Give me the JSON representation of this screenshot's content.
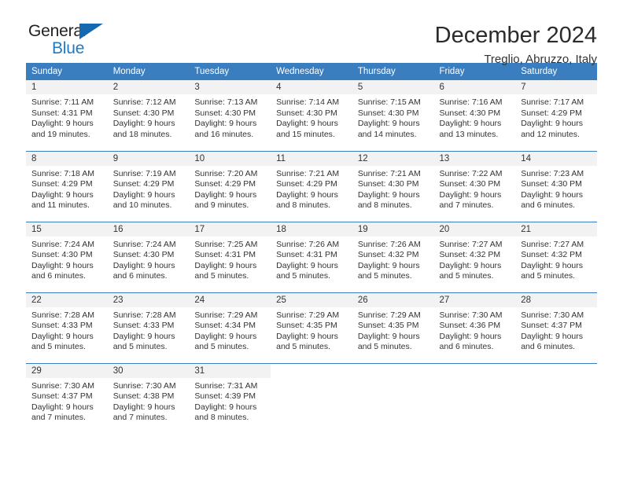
{
  "brand": {
    "name_top": "General",
    "name_bottom": "Blue",
    "triangle_color": "#1469b0",
    "blue_color": "#1e7bc4"
  },
  "header": {
    "title": "December 2024",
    "subtitle": "Treglio, Abruzzo, Italy"
  },
  "theme": {
    "header_bg": "#3a7ebf",
    "header_text": "#ffffff",
    "daynum_bg": "#f2f2f2",
    "body_text": "#333333"
  },
  "weekday_headers": [
    "Sunday",
    "Monday",
    "Tuesday",
    "Wednesday",
    "Thursday",
    "Friday",
    "Saturday"
  ],
  "weeks": [
    [
      {
        "day": "1",
        "sunrise": "Sunrise: 7:11 AM",
        "sunset": "Sunset: 4:31 PM",
        "daylight_line1": "Daylight: 9 hours",
        "daylight_line2": "and 19 minutes."
      },
      {
        "day": "2",
        "sunrise": "Sunrise: 7:12 AM",
        "sunset": "Sunset: 4:30 PM",
        "daylight_line1": "Daylight: 9 hours",
        "daylight_line2": "and 18 minutes."
      },
      {
        "day": "3",
        "sunrise": "Sunrise: 7:13 AM",
        "sunset": "Sunset: 4:30 PM",
        "daylight_line1": "Daylight: 9 hours",
        "daylight_line2": "and 16 minutes."
      },
      {
        "day": "4",
        "sunrise": "Sunrise: 7:14 AM",
        "sunset": "Sunset: 4:30 PM",
        "daylight_line1": "Daylight: 9 hours",
        "daylight_line2": "and 15 minutes."
      },
      {
        "day": "5",
        "sunrise": "Sunrise: 7:15 AM",
        "sunset": "Sunset: 4:30 PM",
        "daylight_line1": "Daylight: 9 hours",
        "daylight_line2": "and 14 minutes."
      },
      {
        "day": "6",
        "sunrise": "Sunrise: 7:16 AM",
        "sunset": "Sunset: 4:30 PM",
        "daylight_line1": "Daylight: 9 hours",
        "daylight_line2": "and 13 minutes."
      },
      {
        "day": "7",
        "sunrise": "Sunrise: 7:17 AM",
        "sunset": "Sunset: 4:29 PM",
        "daylight_line1": "Daylight: 9 hours",
        "daylight_line2": "and 12 minutes."
      }
    ],
    [
      {
        "day": "8",
        "sunrise": "Sunrise: 7:18 AM",
        "sunset": "Sunset: 4:29 PM",
        "daylight_line1": "Daylight: 9 hours",
        "daylight_line2": "and 11 minutes."
      },
      {
        "day": "9",
        "sunrise": "Sunrise: 7:19 AM",
        "sunset": "Sunset: 4:29 PM",
        "daylight_line1": "Daylight: 9 hours",
        "daylight_line2": "and 10 minutes."
      },
      {
        "day": "10",
        "sunrise": "Sunrise: 7:20 AM",
        "sunset": "Sunset: 4:29 PM",
        "daylight_line1": "Daylight: 9 hours",
        "daylight_line2": "and 9 minutes."
      },
      {
        "day": "11",
        "sunrise": "Sunrise: 7:21 AM",
        "sunset": "Sunset: 4:29 PM",
        "daylight_line1": "Daylight: 9 hours",
        "daylight_line2": "and 8 minutes."
      },
      {
        "day": "12",
        "sunrise": "Sunrise: 7:21 AM",
        "sunset": "Sunset: 4:30 PM",
        "daylight_line1": "Daylight: 9 hours",
        "daylight_line2": "and 8 minutes."
      },
      {
        "day": "13",
        "sunrise": "Sunrise: 7:22 AM",
        "sunset": "Sunset: 4:30 PM",
        "daylight_line1": "Daylight: 9 hours",
        "daylight_line2": "and 7 minutes."
      },
      {
        "day": "14",
        "sunrise": "Sunrise: 7:23 AM",
        "sunset": "Sunset: 4:30 PM",
        "daylight_line1": "Daylight: 9 hours",
        "daylight_line2": "and 6 minutes."
      }
    ],
    [
      {
        "day": "15",
        "sunrise": "Sunrise: 7:24 AM",
        "sunset": "Sunset: 4:30 PM",
        "daylight_line1": "Daylight: 9 hours",
        "daylight_line2": "and 6 minutes."
      },
      {
        "day": "16",
        "sunrise": "Sunrise: 7:24 AM",
        "sunset": "Sunset: 4:30 PM",
        "daylight_line1": "Daylight: 9 hours",
        "daylight_line2": "and 6 minutes."
      },
      {
        "day": "17",
        "sunrise": "Sunrise: 7:25 AM",
        "sunset": "Sunset: 4:31 PM",
        "daylight_line1": "Daylight: 9 hours",
        "daylight_line2": "and 5 minutes."
      },
      {
        "day": "18",
        "sunrise": "Sunrise: 7:26 AM",
        "sunset": "Sunset: 4:31 PM",
        "daylight_line1": "Daylight: 9 hours",
        "daylight_line2": "and 5 minutes."
      },
      {
        "day": "19",
        "sunrise": "Sunrise: 7:26 AM",
        "sunset": "Sunset: 4:32 PM",
        "daylight_line1": "Daylight: 9 hours",
        "daylight_line2": "and 5 minutes."
      },
      {
        "day": "20",
        "sunrise": "Sunrise: 7:27 AM",
        "sunset": "Sunset: 4:32 PM",
        "daylight_line1": "Daylight: 9 hours",
        "daylight_line2": "and 5 minutes."
      },
      {
        "day": "21",
        "sunrise": "Sunrise: 7:27 AM",
        "sunset": "Sunset: 4:32 PM",
        "daylight_line1": "Daylight: 9 hours",
        "daylight_line2": "and 5 minutes."
      }
    ],
    [
      {
        "day": "22",
        "sunrise": "Sunrise: 7:28 AM",
        "sunset": "Sunset: 4:33 PM",
        "daylight_line1": "Daylight: 9 hours",
        "daylight_line2": "and 5 minutes."
      },
      {
        "day": "23",
        "sunrise": "Sunrise: 7:28 AM",
        "sunset": "Sunset: 4:33 PM",
        "daylight_line1": "Daylight: 9 hours",
        "daylight_line2": "and 5 minutes."
      },
      {
        "day": "24",
        "sunrise": "Sunrise: 7:29 AM",
        "sunset": "Sunset: 4:34 PM",
        "daylight_line1": "Daylight: 9 hours",
        "daylight_line2": "and 5 minutes."
      },
      {
        "day": "25",
        "sunrise": "Sunrise: 7:29 AM",
        "sunset": "Sunset: 4:35 PM",
        "daylight_line1": "Daylight: 9 hours",
        "daylight_line2": "and 5 minutes."
      },
      {
        "day": "26",
        "sunrise": "Sunrise: 7:29 AM",
        "sunset": "Sunset: 4:35 PM",
        "daylight_line1": "Daylight: 9 hours",
        "daylight_line2": "and 5 minutes."
      },
      {
        "day": "27",
        "sunrise": "Sunrise: 7:30 AM",
        "sunset": "Sunset: 4:36 PM",
        "daylight_line1": "Daylight: 9 hours",
        "daylight_line2": "and 6 minutes."
      },
      {
        "day": "28",
        "sunrise": "Sunrise: 7:30 AM",
        "sunset": "Sunset: 4:37 PM",
        "daylight_line1": "Daylight: 9 hours",
        "daylight_line2": "and 6 minutes."
      }
    ],
    [
      {
        "day": "29",
        "sunrise": "Sunrise: 7:30 AM",
        "sunset": "Sunset: 4:37 PM",
        "daylight_line1": "Daylight: 9 hours",
        "daylight_line2": "and 7 minutes."
      },
      {
        "day": "30",
        "sunrise": "Sunrise: 7:30 AM",
        "sunset": "Sunset: 4:38 PM",
        "daylight_line1": "Daylight: 9 hours",
        "daylight_line2": "and 7 minutes."
      },
      {
        "day": "31",
        "sunrise": "Sunrise: 7:31 AM",
        "sunset": "Sunset: 4:39 PM",
        "daylight_line1": "Daylight: 9 hours",
        "daylight_line2": "and 8 minutes."
      },
      {
        "day": "",
        "sunrise": "",
        "sunset": "",
        "daylight_line1": "",
        "daylight_line2": ""
      },
      {
        "day": "",
        "sunrise": "",
        "sunset": "",
        "daylight_line1": "",
        "daylight_line2": ""
      },
      {
        "day": "",
        "sunrise": "",
        "sunset": "",
        "daylight_line1": "",
        "daylight_line2": ""
      },
      {
        "day": "",
        "sunrise": "",
        "sunset": "",
        "daylight_line1": "",
        "daylight_line2": ""
      }
    ]
  ]
}
